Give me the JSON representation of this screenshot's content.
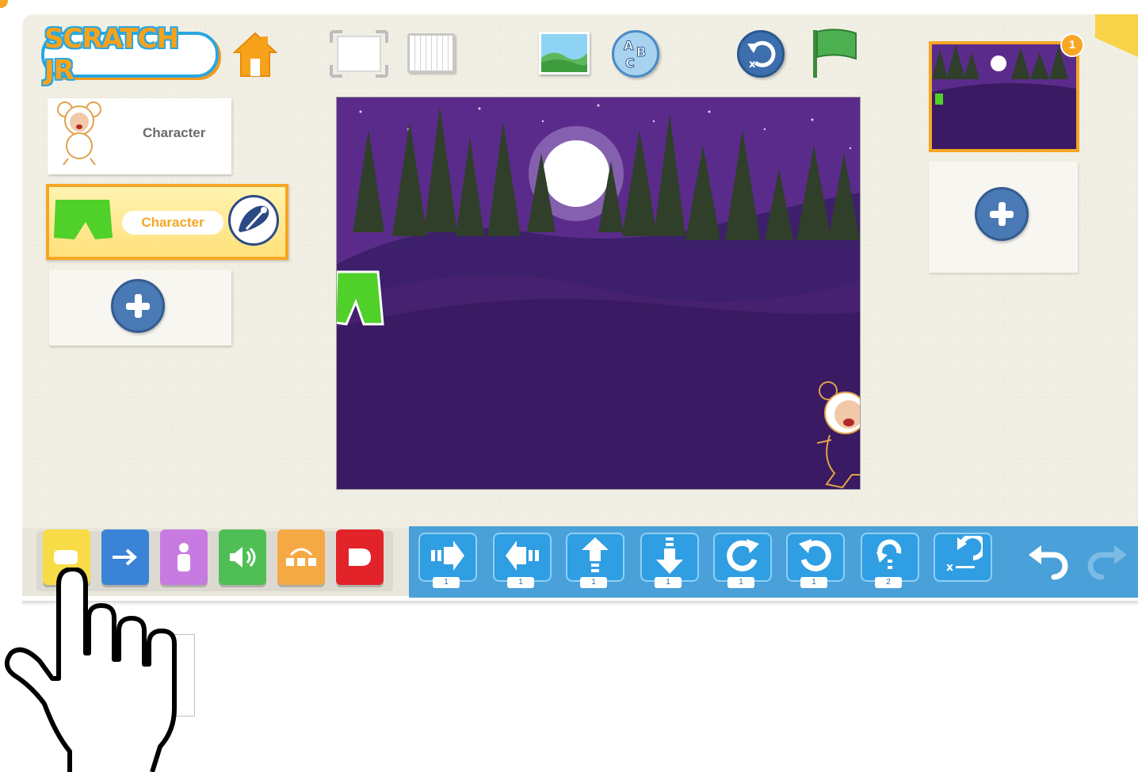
{
  "app": {
    "logo_text": "SCRATCH JR"
  },
  "toolbar": {
    "items": [
      "home-icon",
      "fullscreen-icon",
      "grid-icon",
      "background-icon",
      "text-icon",
      "reset-icon",
      "green-flag-icon"
    ]
  },
  "sprites": {
    "items": [
      {
        "label": "Character",
        "selected": false
      },
      {
        "label": "Character",
        "selected": true
      }
    ]
  },
  "pages": {
    "count_badge": "1"
  },
  "palette": {
    "categories": [
      "triggering",
      "motion",
      "looks",
      "sound",
      "control",
      "end"
    ],
    "blocks": [
      {
        "name": "move-right",
        "count": "1"
      },
      {
        "name": "move-left",
        "count": "1"
      },
      {
        "name": "move-up",
        "count": "1"
      },
      {
        "name": "move-down",
        "count": "1"
      },
      {
        "name": "turn-right",
        "count": "1"
      },
      {
        "name": "turn-left",
        "count": "1"
      },
      {
        "name": "hop",
        "count": "2"
      },
      {
        "name": "go-home",
        "count": ""
      }
    ]
  },
  "colors": {
    "accent": "#f5a623",
    "stage_purple": "#3b1a66",
    "palette_blue": "#4aa0d9",
    "cream": "#f1efe4"
  }
}
